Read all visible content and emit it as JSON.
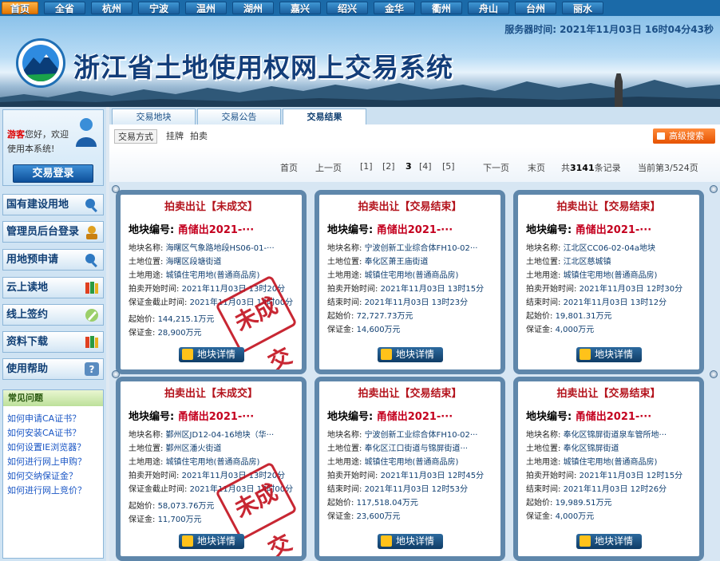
{
  "nav": {
    "items": [
      "首页",
      "全省",
      "杭州",
      "宁波",
      "温州",
      "湖州",
      "嘉兴",
      "绍兴",
      "金华",
      "衢州",
      "舟山",
      "台州",
      "丽水"
    ]
  },
  "header": {
    "system_name": "浙江省土地使用权网上交易系统",
    "server_time_label": "服务器时间:",
    "server_date": "2021年11月03日",
    "server_clock": "16时04分43秒"
  },
  "sidebar": {
    "guest": "游客",
    "welcome_text": "您好，欢迎使用本系统!",
    "login": "交易登录",
    "menu": [
      "国有建设用地",
      "管理员后台登录",
      "用地预申请",
      "云上读地",
      "线上签约",
      "资料下载",
      "使用帮助"
    ],
    "faq_title": "常见问题",
    "faq": [
      "如何申请CA证书？",
      "如何安装CA证书？",
      "如何设置IE浏览器？",
      "如何进行网上申购？",
      "如何交纳保证金？",
      "如何进行网上竞价？"
    ]
  },
  "tabs": [
    "交易地块",
    "交易公告",
    "交易结果"
  ],
  "filters": {
    "mode": "交易方式",
    "opt1": "挂牌",
    "opt2": "拍卖",
    "advanced": "高级搜索"
  },
  "pager": {
    "first": "首页",
    "prev": "上一页",
    "p1": "[1]",
    "p2": "[2]",
    "p3": "3",
    "p4": "[4]",
    "p5": "[5]",
    "next": "下一页",
    "last": "末页",
    "total_pre": "共",
    "total": "3141",
    "total_post": "条记录",
    "current": "当前第3/524页"
  },
  "labels": {
    "plot_no": "地块编号:",
    "name": "地块名称:",
    "location": "土地位置:",
    "use": "土地用途:",
    "start": "拍卖开始时间:",
    "deposit_end": "保证金截止时间:",
    "end": "结束时间:",
    "start_price": "起始价:",
    "deposit": "保证金:",
    "detail": "地块详情",
    "unsold_stamp": "未成交"
  },
  "cards": [
    {
      "status": "拍卖出让【未成交】",
      "plot_no": "甬储出2021-···",
      "name": "海曙区气象路地段HS06-01-···",
      "location": "海曙区段塘街道",
      "use": "城镇住宅用地(普通商品房)",
      "start": "2021年11月03日 13时20分",
      "time2": "2021年11月03日 14时00分",
      "start_price": "144,215.1万元",
      "deposit": "28,900万元",
      "unsold": true
    },
    {
      "status": "拍卖出让【交易结束】",
      "plot_no": "甬储出2021-···",
      "name": "宁波创新工业综合体FH10-02···",
      "location": "奉化区萧王庙街道",
      "use": "城镇住宅用地(普通商品房)",
      "start": "2021年11月03日 13时15分",
      "time2": "2021年11月03日 13时23分",
      "start_price": "72,727.73万元",
      "deposit": "14,600万元",
      "unsold": false
    },
    {
      "status": "拍卖出让【交易结束】",
      "plot_no": "甬储出2021-···",
      "name": "江北区CC06-02-04a地块",
      "location": "江北区慈城镇",
      "use": "城镇住宅用地(普通商品房)",
      "start": "2021年11月03日 12时30分",
      "time2": "2021年11月03日 13时12分",
      "start_price": "19,801.31万元",
      "deposit": "4,000万元",
      "unsold": false
    },
    {
      "status": "拍卖出让【未成交】",
      "plot_no": "甬储出2021-···",
      "name": "鄞州区JD12-04-16地块（华···",
      "location": "鄞州区潘火街道",
      "use": "城镇住宅用地(普通商品房)",
      "start": "2021年11月03日 13时20分",
      "time2": "2021年11月03日 14时00分",
      "start_price": "58,073.76万元",
      "deposit": "11,700万元",
      "unsold": true
    },
    {
      "status": "拍卖出让【交易结束】",
      "plot_no": "甬储出2021-···",
      "name": "宁波创新工业综合体FH10-02···",
      "location": "奉化区江口街道与锦屏街道···",
      "use": "城镇住宅用地(普通商品房)",
      "start": "2021年11月03日 12时45分",
      "time2": "2021年11月03日 12时53分",
      "start_price": "117,518.04万元",
      "deposit": "23,600万元",
      "unsold": false
    },
    {
      "status": "拍卖出让【交易结束】",
      "plot_no": "甬储出2021-···",
      "name": "奉化区锦屏街道泉车管所地···",
      "location": "奉化区锦屏街道",
      "use": "城镇住宅用地(普通商品房)",
      "start": "2021年11月03日 12时15分",
      "time2": "2021年11月03日 12时26分",
      "start_price": "19,989.51万元",
      "deposit": "4,000万元",
      "unsold": false
    }
  ]
}
